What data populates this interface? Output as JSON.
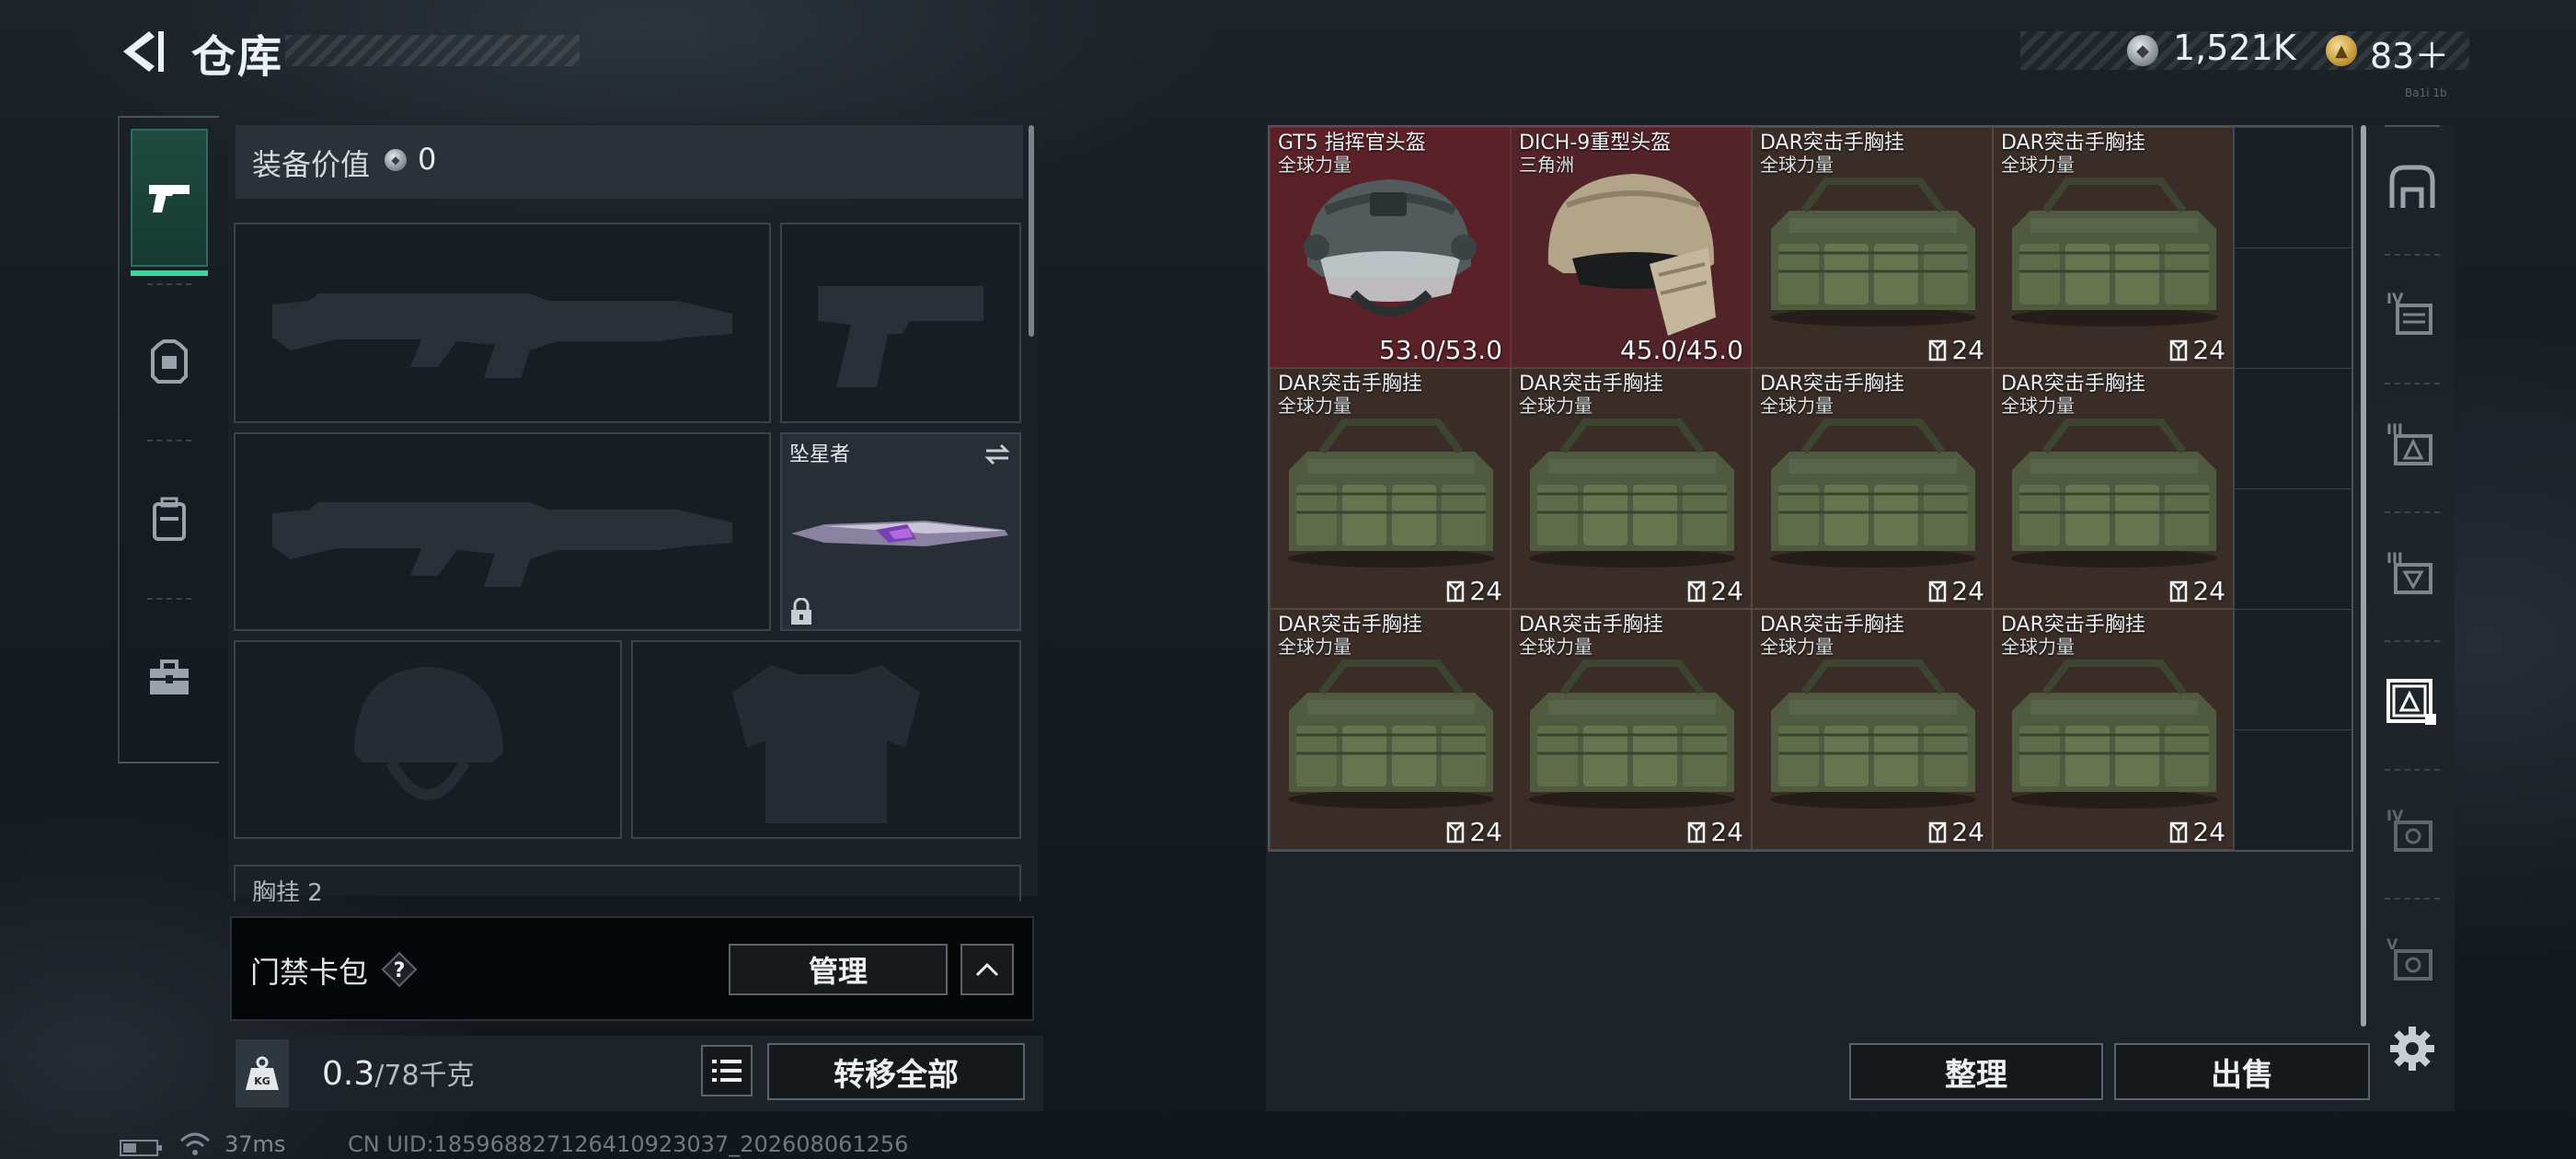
{
  "header": {
    "title": "仓库",
    "currency": {
      "silver_amount": "1,521K",
      "gold_amount": "83＋",
      "top_right_tiny": "Ba1i 1b"
    }
  },
  "left_rail": {
    "items": [
      "pistol-icon",
      "armor-icon",
      "backpack-icon",
      "briefcase-icon"
    ],
    "active_index": 0,
    "accent_color": "#3fd4a0"
  },
  "equipment": {
    "value_label": "装备价值",
    "value_amount": "0",
    "melee": {
      "name": "坠星者"
    },
    "chest_rig_label": "胸挂 2"
  },
  "keycard": {
    "label": "门禁卡包",
    "help": "?",
    "manage_label": "管理"
  },
  "weight": {
    "current": "0.3",
    "capacity": "/78千克",
    "icon_text": "KG",
    "transfer_all_label": "转移全部"
  },
  "status": {
    "ping": "37ms",
    "uid": "CN UID:185968827126410923037_202608061256"
  },
  "stash": {
    "items": [
      {
        "name": "GT5 指挥官头盔",
        "sub": "全球力量",
        "value": "53.0/53.0",
        "kind": "helmet-gt5"
      },
      {
        "name": "DICH-9重型头盔",
        "sub": "三角洲",
        "value": "45.0/45.0",
        "kind": "helmet-dich"
      },
      {
        "name": "DAR突击手胸挂",
        "sub": "全球力量",
        "value": "24",
        "kind": "rig"
      },
      {
        "name": "DAR突击手胸挂",
        "sub": "全球力量",
        "value": "24",
        "kind": "rig"
      },
      {
        "name": "DAR突击手胸挂",
        "sub": "全球力量",
        "value": "24",
        "kind": "rig"
      },
      {
        "name": "DAR突击手胸挂",
        "sub": "全球力量",
        "value": "24",
        "kind": "rig"
      },
      {
        "name": "DAR突击手胸挂",
        "sub": "全球力量",
        "value": "24",
        "kind": "rig"
      },
      {
        "name": "DAR突击手胸挂",
        "sub": "全球力量",
        "value": "24",
        "kind": "rig"
      },
      {
        "name": "DAR突击手胸挂",
        "sub": "全球力量",
        "value": "24",
        "kind": "rig"
      },
      {
        "name": "DAR突击手胸挂",
        "sub": "全球力量",
        "value": "24",
        "kind": "rig"
      },
      {
        "name": "DAR突击手胸挂",
        "sub": "全球力量",
        "value": "24",
        "kind": "rig"
      },
      {
        "name": "DAR突击手胸挂",
        "sub": "全球力量",
        "value": "24",
        "kind": "rig"
      }
    ],
    "sort_label": "整理",
    "sell_label": "出售"
  },
  "right_rail": {
    "items": [
      "safe-box-icon",
      "tier-4-armor-filter-icon",
      "tier-3-rig-filter-icon",
      "tier-3-rig-filter-icon-2",
      "rig-filter-selected-icon",
      "tier-4-backpack-filter-icon",
      "tier-5-backpack-filter-icon",
      "settings-gear-icon"
    ],
    "labels": [
      "IV",
      "III",
      "III",
      "IV",
      "V"
    ]
  }
}
